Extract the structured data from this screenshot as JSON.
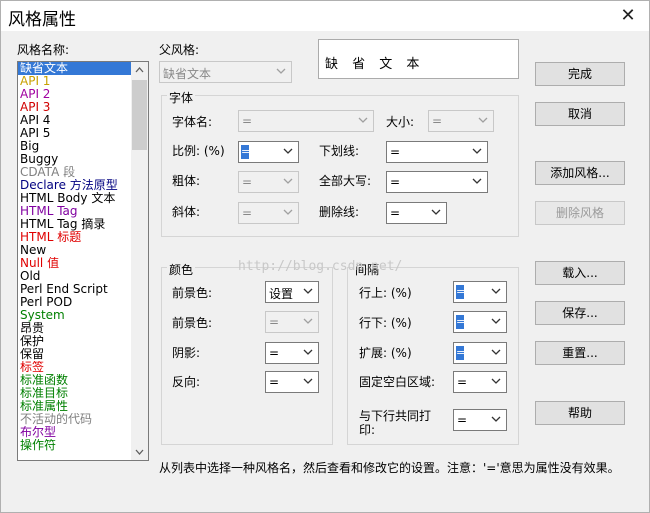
{
  "window": {
    "title": "风格属性"
  },
  "style_names": {
    "label": "风格名称:",
    "items": [
      {
        "text": "缺省文本",
        "color": "#ffffff",
        "selected": true
      },
      {
        "text": "API 1",
        "color": "#c8a000"
      },
      {
        "text": "API 2",
        "color": "#a000a0"
      },
      {
        "text": "API 3",
        "color": "#d00000"
      },
      {
        "text": "API 4",
        "color": "#000000"
      },
      {
        "text": "API 5",
        "color": "#000000"
      },
      {
        "text": "Big",
        "color": "#000000"
      },
      {
        "text": "Buggy",
        "color": "#000000"
      },
      {
        "text": "CDATA 段",
        "color": "#808080"
      },
      {
        "text": "Declare 方法原型",
        "color": "#000080"
      },
      {
        "text": "HTML Body 文本",
        "color": "#000000"
      },
      {
        "text": "HTML Tag",
        "color": "#8000a0"
      },
      {
        "text": "HTML Tag 摘录",
        "color": "#000000"
      },
      {
        "text": "HTML 标题",
        "color": "#e00000"
      },
      {
        "text": "New",
        "color": "#000000"
      },
      {
        "text": "Null 值",
        "color": "#e00000"
      },
      {
        "text": "Old",
        "color": "#000000"
      },
      {
        "text": "Perl End Script",
        "color": "#000000"
      },
      {
        "text": "Perl POD",
        "color": "#000000"
      },
      {
        "text": "System",
        "color": "#008000"
      },
      {
        "text": "昂贵",
        "color": "#000000"
      },
      {
        "text": "保护",
        "color": "#000000"
      },
      {
        "text": "保留",
        "color": "#000000"
      },
      {
        "text": "标签",
        "color": "#e00000"
      },
      {
        "text": "标准函数",
        "color": "#008000"
      },
      {
        "text": "标准目标",
        "color": "#008000"
      },
      {
        "text": "标准属性",
        "color": "#008000"
      },
      {
        "text": "不活动的代码",
        "color": "#808080"
      },
      {
        "text": "布尔型",
        "color": "#8000a0"
      },
      {
        "text": "操作符",
        "color": "#008000"
      }
    ]
  },
  "parent_style": {
    "label": "父风格:",
    "value": "缺省文本"
  },
  "preview": {
    "text": "缺 省 文 本"
  },
  "font_group": {
    "title": "字体",
    "font_name": {
      "label": "字体名:",
      "value": "="
    },
    "size": {
      "label": "大小:",
      "value": "="
    },
    "scale": {
      "label": "比例: (%)",
      "value": "="
    },
    "underline": {
      "label": "下划线:",
      "value": "="
    },
    "bold": {
      "label": "粗体:",
      "value": "="
    },
    "all_caps": {
      "label": "全部大写:",
      "value": "="
    },
    "italic": {
      "label": "斜体:",
      "value": "="
    },
    "strikethrough": {
      "label": "删除线:",
      "value": "="
    }
  },
  "color_group": {
    "title": "颜色",
    "fg1": {
      "label": "前景色:",
      "value": "设置"
    },
    "fg2": {
      "label": "前景色:",
      "value": "="
    },
    "shadow": {
      "label": "阴影:",
      "value": "="
    },
    "reverse": {
      "label": "反向:",
      "value": "="
    }
  },
  "spacing_group": {
    "title": "间隔",
    "above": {
      "label": "行上: (%)",
      "value": "="
    },
    "below": {
      "label": "行下: (%)",
      "value": "="
    },
    "expand": {
      "label": "扩展: (%)",
      "value": "="
    },
    "fixed": {
      "label": "固定空白区域:",
      "value": "="
    },
    "print_with_next": {
      "label": "与下行共同打印:",
      "value": "="
    }
  },
  "buttons": {
    "done": "完成",
    "cancel": "取消",
    "add_style": "添加风格...",
    "delete_style": "删除风格",
    "load": "载入...",
    "save": "保存...",
    "reset": "重置...",
    "help": "帮助"
  },
  "watermark": "http://blog.csdn.net/",
  "status_text": "从列表中选择一种风格名，然后查看和修改它的设置。注意：'='意思为属性没有效果。",
  "colors": {
    "selection": "#3478d6",
    "panel": "#f0f0f0"
  }
}
